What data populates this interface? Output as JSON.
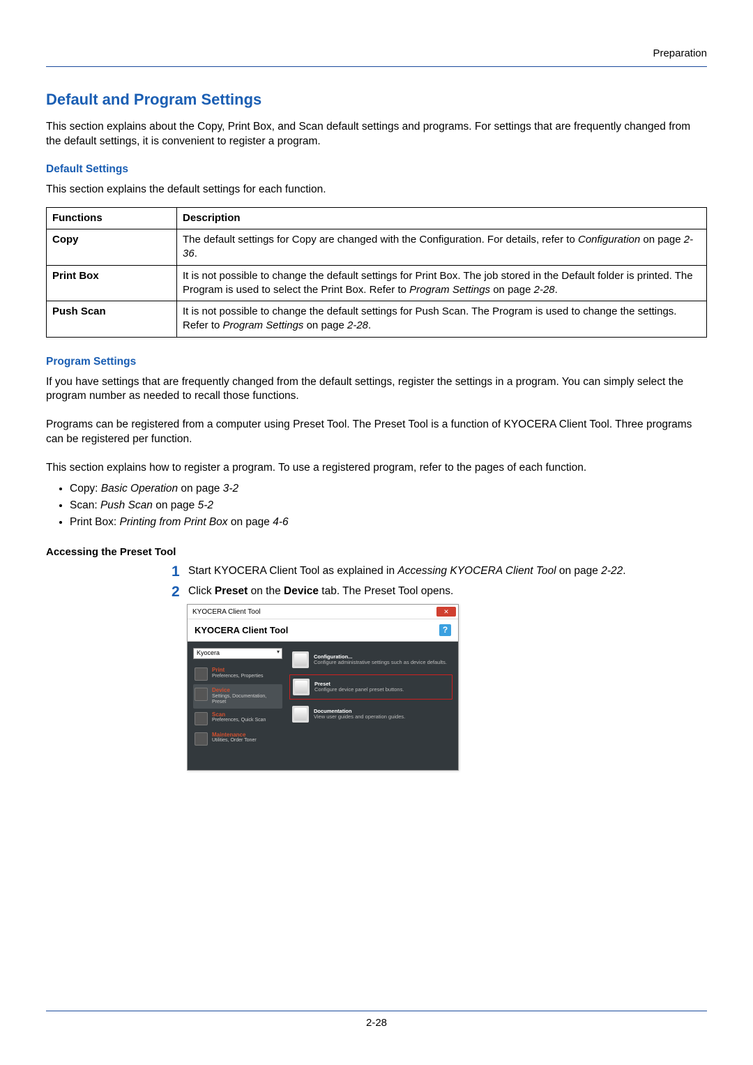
{
  "header": {
    "breadcrumb": "Preparation"
  },
  "title": "Default and Program Settings",
  "intro": "This section explains about the Copy, Print Box, and Scan default settings and programs. For settings that are frequently changed from the default settings, it is convenient to register a program.",
  "default_section": {
    "heading": "Default Settings",
    "para": "This section explains the default settings for each function.",
    "table": {
      "head": {
        "c1": "Functions",
        "c2": "Description"
      },
      "rows": [
        {
          "c1": "Copy",
          "c2_pre": "The default settings for Copy are changed with the Configuration. For details, refer to ",
          "c2_link": "Configuration",
          "c2_mid": " on page ",
          "c2_page": "2-36",
          "c2_post": "."
        },
        {
          "c1": "Print Box",
          "c2_pre": "It is not possible to change the default settings for Print Box. The job stored in the Default folder is printed. The Program is used to select the Print Box. Refer to ",
          "c2_link": "Program Settings",
          "c2_mid": " on page ",
          "c2_page": "2-28",
          "c2_post": "."
        },
        {
          "c1": "Push Scan",
          "c2_pre": "It is not possible to change the default settings for Push Scan. The Program is used to change the settings. Refer to ",
          "c2_link": "Program Settings",
          "c2_mid": " on page ",
          "c2_page": "2-28",
          "c2_post": "."
        }
      ]
    }
  },
  "program_section": {
    "heading": "Program Settings",
    "para1": "If you have settings that are frequently changed from the default settings, register the settings in a program. You can simply select the program number as needed to recall those functions.",
    "para2": "Programs can be registered from a computer using Preset Tool. The Preset Tool is a function of KYOCERA Client Tool. Three programs can be registered per function.",
    "para3": "This section explains how to register a program. To use a registered program, refer to the pages of each function.",
    "bullets": [
      {
        "pre": "Copy: ",
        "link": "Basic Operation",
        "mid": " on page ",
        "page": "3-2"
      },
      {
        "pre": "Scan: ",
        "link": "Push Scan",
        "mid": " on page ",
        "page": "5-2"
      },
      {
        "pre": "Print Box: ",
        "link": "Printing from Print Box",
        "mid": " on page ",
        "page": "4-6"
      }
    ]
  },
  "accessing": {
    "heading": "Accessing the Preset Tool",
    "step1": {
      "num": "1",
      "pre": "Start KYOCERA Client Tool as explained in ",
      "link": "Accessing KYOCERA Client Tool",
      "mid": " on page ",
      "page": "2-22",
      "post": "."
    },
    "step2": {
      "num": "2",
      "pre": "Click ",
      "b1": "Preset",
      "mid1": " on the ",
      "b2": "Device",
      "post": " tab. The Preset Tool opens."
    }
  },
  "dialog": {
    "titlebar": "KYOCERA Client Tool",
    "close": "✕",
    "header": "KYOCERA Client Tool",
    "help": "?",
    "dropdown": "Kyocera",
    "side": [
      {
        "label": "Print",
        "sub": "Preferences, Properties"
      },
      {
        "label": "Device",
        "sub": "Settings, Documentation, Preset",
        "active": true
      },
      {
        "label": "Scan",
        "sub": "Preferences, Quick Scan"
      },
      {
        "label": "Maintenance",
        "sub": "Utilities, Order Toner"
      }
    ],
    "main": [
      {
        "label": "Configuration...",
        "sub": "Configure administrative settings such as device defaults."
      },
      {
        "label": "Preset",
        "sub": "Configure device panel preset buttons.",
        "highlight": true
      },
      {
        "label": "Documentation",
        "sub": "View user guides and operation guides."
      }
    ]
  },
  "footer": {
    "page": "2-28"
  }
}
